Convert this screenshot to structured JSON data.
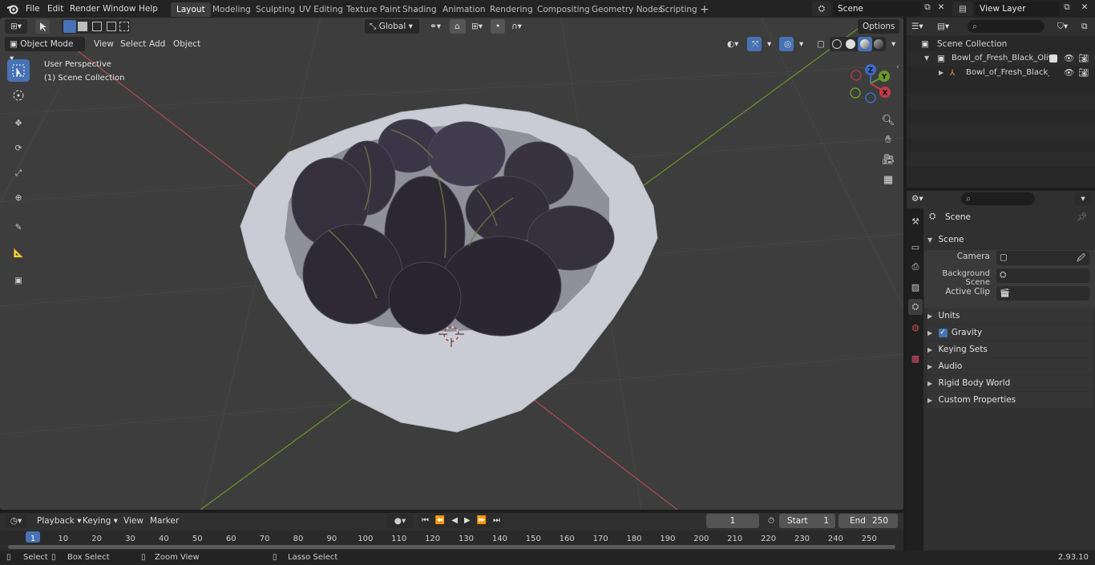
{
  "app": {
    "logo_icon": "blender-logo-icon",
    "menu": [
      "File",
      "Edit",
      "Render",
      "Window",
      "Help"
    ],
    "workspaces": [
      "Layout",
      "Modeling",
      "Sculpting",
      "UV Editing",
      "Texture Paint",
      "Shading",
      "Animation",
      "Rendering",
      "Compositing",
      "Geometry Nodes",
      "Scripting"
    ],
    "active_workspace": "Layout",
    "add_workspace": "+",
    "scene_name": "Scene",
    "view_layer": "View Layer"
  },
  "viewport": {
    "mode": "Object Mode",
    "menus": [
      "View",
      "Select",
      "Add",
      "Object"
    ],
    "transform_orientation": "Global",
    "options_label": "Options",
    "overlay_line1": "User Perspective",
    "overlay_line2": "(1) Scene Collection",
    "gizmo_axes": {
      "z": "Z",
      "y": "Y",
      "x": "X"
    },
    "colors": {
      "background": "#3d3d3d",
      "grid": "#4a4a4a",
      "x_axis": "#a84a4f",
      "y_axis": "#6a8f2a",
      "bowl": "#c8cbd3",
      "olive": "#2e2a37"
    }
  },
  "outliner": {
    "root": "Scene Collection",
    "items": [
      {
        "label": "Bowl_of_Fresh_Black_Olives",
        "type": "collection"
      },
      {
        "label": "Bowl_of_Fresh_Black_Oli",
        "type": "object"
      }
    ]
  },
  "properties": {
    "context_title": "Scene",
    "panel_title": "Scene",
    "fields": [
      {
        "label": "Camera",
        "icon": "camera-icon"
      },
      {
        "label": "Background Scene",
        "icon": "scene-icon"
      },
      {
        "label": "Active Clip",
        "icon": "clip-icon"
      }
    ],
    "subpanels": [
      "Units",
      "Gravity",
      "Keying Sets",
      "Audio",
      "Rigid Body World",
      "Custom Properties"
    ],
    "gravity_checked": true
  },
  "timeline": {
    "menus": [
      "Playback",
      "Keying",
      "View",
      "Marker"
    ],
    "current_frame": "1",
    "start_label": "Start",
    "start_value": "1",
    "end_label": "End",
    "end_value": "250",
    "ruler": [
      "1",
      "10",
      "20",
      "30",
      "40",
      "50",
      "60",
      "70",
      "80",
      "90",
      "100",
      "110",
      "120",
      "130",
      "140",
      "150",
      "160",
      "170",
      "180",
      "190",
      "200",
      "210",
      "220",
      "230",
      "240",
      "250"
    ]
  },
  "statusbar": {
    "select": "Select",
    "box_select": "Box Select",
    "zoom_view": "Zoom View",
    "lasso_select": "Lasso Select",
    "version": "2.93.10"
  }
}
